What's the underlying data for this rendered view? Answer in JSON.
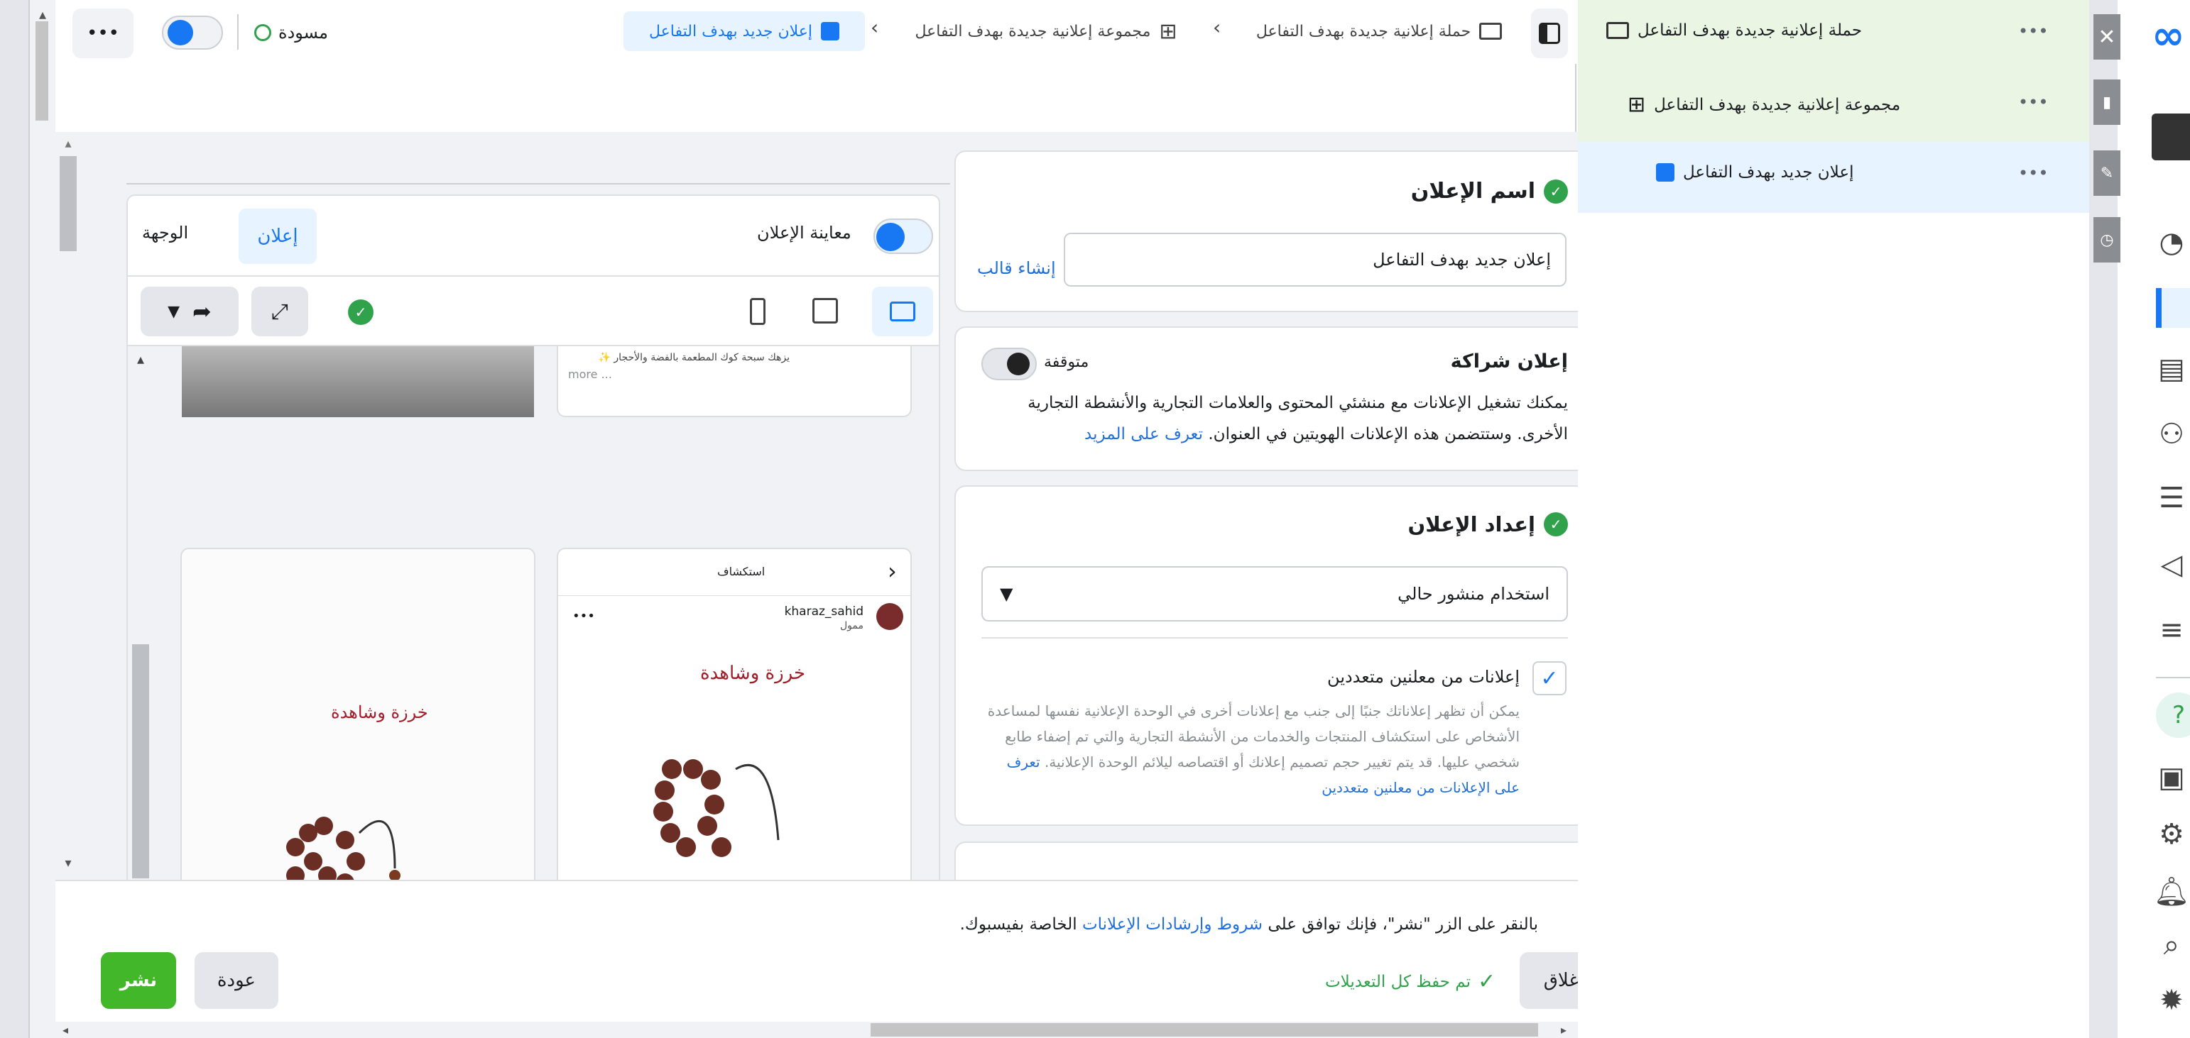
{
  "topbar": {
    "draft_label": "مسودة",
    "breadcrumb_campaign": "حملة إعلانية جديدة بهدف التفاعل",
    "breadcrumb_adset": "مجموعة إعلانية جديدة بهدف التفاعل",
    "breadcrumb_ad": "إعلان جديد بهدف التفاعل",
    "more": "•••"
  },
  "ad_name": {
    "title": "اسم الإعلان",
    "value": "إعلان جديد بهدف التفاعل",
    "create_template": "إنشاء قالب"
  },
  "partnership": {
    "title": "إعلان شراكة",
    "status": "متوقفة",
    "desc": "يمكنك تشغيل الإعلانات مع منشئي المحتوى والعلامات التجارية والأنشطة التجارية الأخرى. وستتضمن هذه الإعلانات الهويتين في العنوان.",
    "learn_more": "تعرف على المزيد"
  },
  "setup": {
    "title": "إعداد الإعلان",
    "dropdown_value": "استخدام منشور حالي",
    "multi_title": "إعلانات من معلنين متعددين",
    "multi_desc": "يمكن أن تظهر إعلاناتك جنبًا إلى جنب مع إعلانات أخرى في الوحدة الإعلانية نفسها لمساعدة الأشخاص على استكشاف المنتجات والخدمات من الأنشطة التجارية والتي تم إضفاء طابع شخصي عليها. قد يتم تغيير حجم تصميم إعلانك أو اقتصاصه ليلائم الوحدة الإعلانية.",
    "multi_link": "تعرف على الإعلانات من معلنين متعددين"
  },
  "preview": {
    "toggle_label": "معاينة الإعلان",
    "tab_ad": "إعلان",
    "tab_destination": "الوجهة",
    "post_text": "يزهك سبحة كوك المطعمة بالفضة والأحجار ✨",
    "post_more": "more ...",
    "explore": "استكشاف",
    "username": "kharaz_sahid",
    "sponsored": "ممول",
    "logo_text": "خرزة وشاهدة",
    "more": "•••"
  },
  "footer": {
    "terms_prefix": "بالنقر على الزر \"نشر\"، فإنك توافق على",
    "terms_link": "شروط وإرشادات الإعلانات",
    "terms_suffix": "الخاصة بفيسبوك.",
    "close": "إغلاق",
    "saved": "تم حفظ كل التعديلات",
    "back": "عودة",
    "publish": "نشر"
  },
  "tree": {
    "campaign": "حملة إعلانية جديدة بهدف التفاعل",
    "adset": "مجموعة إعلانية جديدة بهدف التفاعل",
    "ad": "إعلان جديد بهدف التفاعل",
    "more": "•••"
  },
  "colors": {
    "accent": "#1877f2",
    "success": "#31a24c",
    "publish": "#42b72a",
    "tree_highlight": "#eaf5e3",
    "tree_selected": "#e7f3ff"
  }
}
